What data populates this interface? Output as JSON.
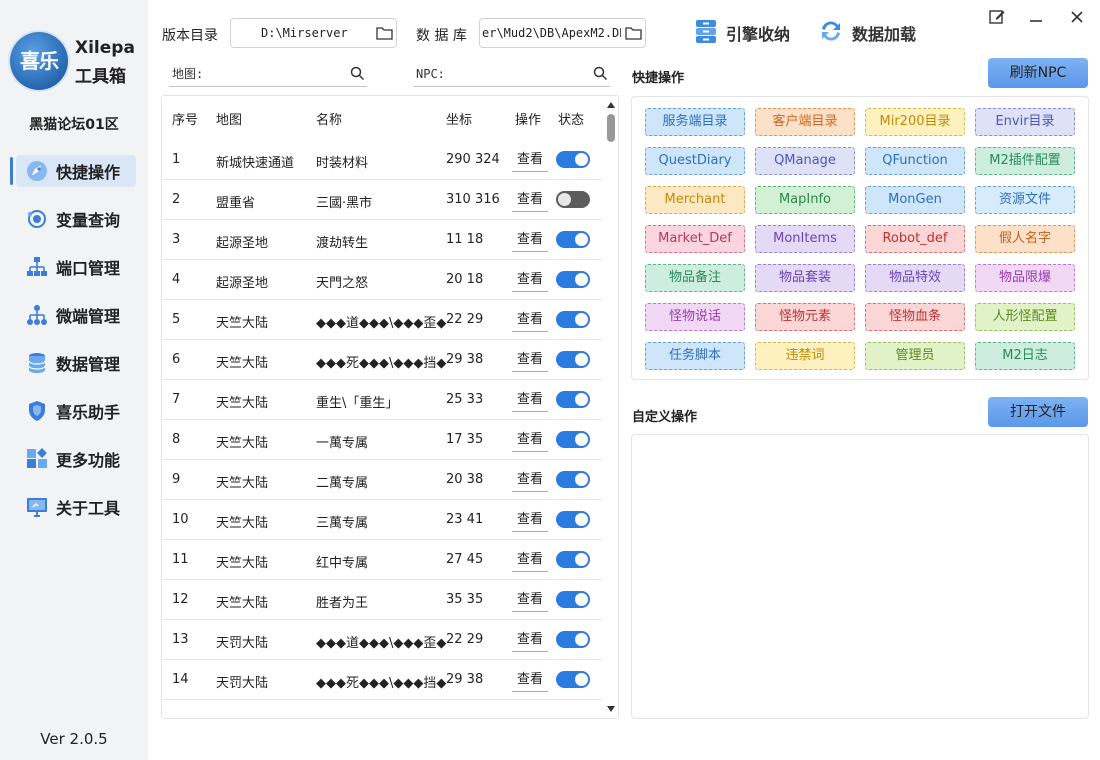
{
  "app": {
    "name": "Xilepa",
    "subtitle": "工具箱",
    "logo_text": "喜乐",
    "forum": "黑猫论坛01区",
    "version": "Ver 2.0.5",
    "accent": "#3b7dd8"
  },
  "sidebar": {
    "items": [
      {
        "label": "快捷操作",
        "icon": "rocket-icon",
        "active": true
      },
      {
        "label": "变量查询",
        "icon": "orbit-icon",
        "active": false
      },
      {
        "label": "端口管理",
        "icon": "network-icon",
        "active": false
      },
      {
        "label": "微端管理",
        "icon": "tree-icon",
        "active": false
      },
      {
        "label": "数据管理",
        "icon": "database-icon",
        "active": false
      },
      {
        "label": "喜乐助手",
        "icon": "shield-icon",
        "active": false
      },
      {
        "label": "更多功能",
        "icon": "apps-icon",
        "active": false
      },
      {
        "label": "关于工具",
        "icon": "monitor-icon",
        "active": false
      }
    ]
  },
  "topbar": {
    "version_dir_label": "版本目录",
    "version_dir_value": "D:\\Mirserver",
    "db_label": "数 据 库",
    "db_value": "er\\Mud2\\DB\\ApexM2.DB",
    "engine_btn": "引擎收纳",
    "data_btn": "数据加载"
  },
  "search": {
    "map_placeholder": "地图:",
    "npc_placeholder": "NPC:"
  },
  "table": {
    "headers": {
      "no": "序号",
      "map": "地图",
      "name": "名称",
      "coord": "坐标",
      "op": "操作",
      "status": "状态"
    },
    "view_label": "查看",
    "rows": [
      {
        "no": "1",
        "map": "新城快速通道",
        "name": "时装材料",
        "coord": "290 324",
        "on": true
      },
      {
        "no": "2",
        "map": "盟重省",
        "name": "三國·黑市",
        "coord": "310 316",
        "on": false
      },
      {
        "no": "3",
        "map": "起源圣地",
        "name": "渡劫转生",
        "coord": "11 18",
        "on": true
      },
      {
        "no": "4",
        "map": "起源圣地",
        "name": "天門之怒",
        "coord": "20 18",
        "on": true
      },
      {
        "no": "5",
        "map": "天竺大陆",
        "name": "◆◆◆道◆◆◆\\◆◆◆歪◆",
        "coord": "22 29",
        "on": true
      },
      {
        "no": "6",
        "map": "天竺大陆",
        "name": "◆◆◆死◆◆◆\\◆◆◆挡◆",
        "coord": "29 38",
        "on": true
      },
      {
        "no": "7",
        "map": "天竺大陆",
        "name": "重生\\「重生」",
        "coord": "25 33",
        "on": true
      },
      {
        "no": "8",
        "map": "天竺大陆",
        "name": "一萬专属",
        "coord": "17 35",
        "on": true
      },
      {
        "no": "9",
        "map": "天竺大陆",
        "name": "二萬专属",
        "coord": "20 38",
        "on": true
      },
      {
        "no": "10",
        "map": "天竺大陆",
        "name": "三萬专属",
        "coord": "23 41",
        "on": true
      },
      {
        "no": "11",
        "map": "天竺大陆",
        "name": "红中专属",
        "coord": "27 45",
        "on": true
      },
      {
        "no": "12",
        "map": "天竺大陆",
        "name": "胜者为王",
        "coord": "35 35",
        "on": true
      },
      {
        "no": "13",
        "map": "天罚大陆",
        "name": "◆◆◆道◆◆◆\\◆◆◆歪◆",
        "coord": "22 29",
        "on": true
      },
      {
        "no": "14",
        "map": "天罚大陆",
        "name": "◆◆◆死◆◆◆\\◆◆◆挡◆",
        "coord": "29 38",
        "on": true
      }
    ]
  },
  "quick": {
    "title": "快捷操作",
    "refresh_btn": "刷新NPC",
    "buttons": [
      {
        "label": "服务端目录",
        "fg": "#2b6fbf",
        "bg": "#cfe5fa",
        "bd": "#6a9fd8"
      },
      {
        "label": "客户端目录",
        "fg": "#d0661c",
        "bg": "#fde0c8",
        "bd": "#e0955a"
      },
      {
        "label": "Mir200目录",
        "fg": "#c48a00",
        "bg": "#fdf1bf",
        "bd": "#d9b44a"
      },
      {
        "label": "Envir目录",
        "fg": "#4a58b8",
        "bg": "#dfe1f7",
        "bd": "#8890d0"
      },
      {
        "label": "QuestDiary",
        "fg": "#2b6fbf",
        "bg": "#cfe5fa",
        "bd": "#6a9fd8"
      },
      {
        "label": "QManage",
        "fg": "#4a58b8",
        "bg": "#dfe1f7",
        "bd": "#8890d0"
      },
      {
        "label": "QFunction",
        "fg": "#2b6fbf",
        "bg": "#cfe5fa",
        "bd": "#6a9fd8"
      },
      {
        "label": "M2插件配置",
        "fg": "#2a8a5a",
        "bg": "#cdeede",
        "bd": "#5fb488"
      },
      {
        "label": "Merchant",
        "fg": "#c48a00",
        "bg": "#fde8c4",
        "bd": "#d9a84a"
      },
      {
        "label": "MapInfo",
        "fg": "#2a8a4a",
        "bg": "#d2f0d6",
        "bd": "#5fb46e"
      },
      {
        "label": "MonGen",
        "fg": "#2b6fbf",
        "bg": "#cfe5fa",
        "bd": "#6a9fd8"
      },
      {
        "label": "资源文件",
        "fg": "#2b6fbf",
        "bg": "#d7ecfb",
        "bd": "#6a9fd8"
      },
      {
        "label": "Market_Def",
        "fg": "#b53a5a",
        "bg": "#fad5df",
        "bd": "#d8708a"
      },
      {
        "label": "MonItems",
        "fg": "#6a44b8",
        "bg": "#e4daf5",
        "bd": "#9a80d0"
      },
      {
        "label": "Robot_def",
        "fg": "#c03030",
        "bg": "#fbd6d6",
        "bd": "#d87070"
      },
      {
        "label": "假人名字",
        "fg": "#c0601c",
        "bg": "#fde0c8",
        "bd": "#e0955a"
      },
      {
        "label": "物品备注",
        "fg": "#2a8a5a",
        "bg": "#cdeede",
        "bd": "#5fb488"
      },
      {
        "label": "物品套装",
        "fg": "#6a44b8",
        "bg": "#e4daf5",
        "bd": "#9a80d0"
      },
      {
        "label": "物品特效",
        "fg": "#6a44b8",
        "bg": "#e4daf5",
        "bd": "#9a80d0"
      },
      {
        "label": "物品限爆",
        "fg": "#9a3ab0",
        "bg": "#f1d8f5",
        "bd": "#c078d0"
      },
      {
        "label": "怪物说话",
        "fg": "#9a3ab0",
        "bg": "#f1d8f5",
        "bd": "#c078d0"
      },
      {
        "label": "怪物元素",
        "fg": "#c03030",
        "bg": "#fbd6d6",
        "bd": "#d87070"
      },
      {
        "label": "怪物血条",
        "fg": "#c03030",
        "bg": "#fbd6d6",
        "bd": "#d87070"
      },
      {
        "label": "人形怪配置",
        "fg": "#5a8a1a",
        "bg": "#e2f2c8",
        "bd": "#98c060"
      },
      {
        "label": "任务脚本",
        "fg": "#2b6fbf",
        "bg": "#cfe5fa",
        "bd": "#6a9fd8"
      },
      {
        "label": "违禁词",
        "fg": "#c48a00",
        "bg": "#fdf1bf",
        "bd": "#d9b44a"
      },
      {
        "label": "管理员",
        "fg": "#5a8a1a",
        "bg": "#e2f2c8",
        "bd": "#98c060"
      },
      {
        "label": "M2日志",
        "fg": "#2a8a5a",
        "bg": "#cdeede",
        "bd": "#5fb488"
      }
    ]
  },
  "custom": {
    "title": "自定义操作",
    "open_btn": "打开文件"
  }
}
